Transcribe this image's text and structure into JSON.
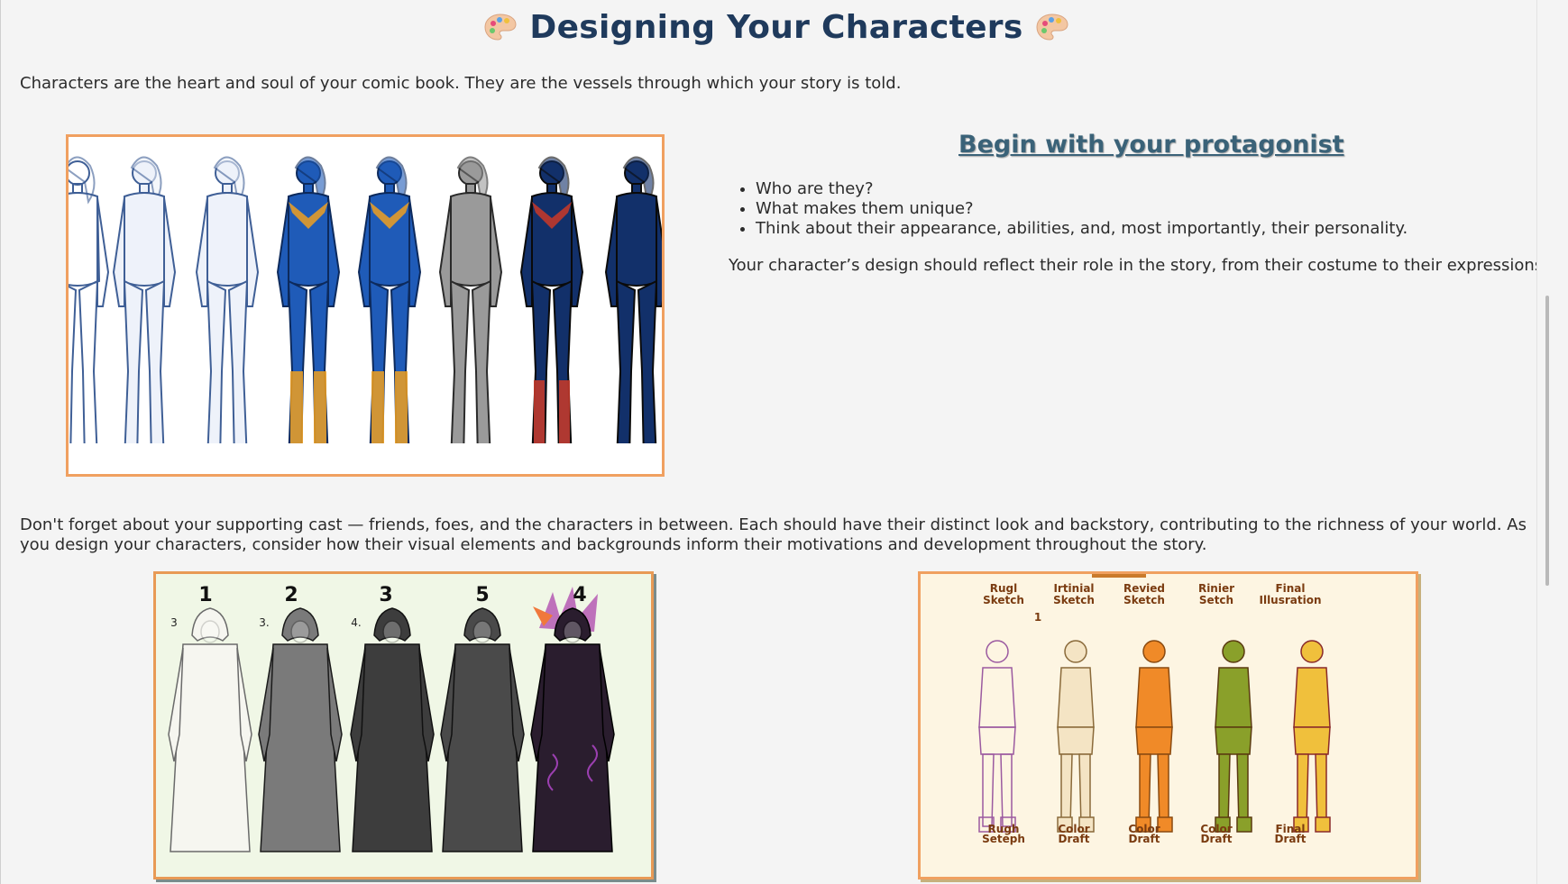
{
  "page": {
    "title": "Designing Your Characters",
    "title_icon": "artist-palette-icon",
    "intro": "Characters are the heart and soul of your comic book. They are the vessels through which your story is told."
  },
  "protagonist": {
    "heading": "Begin with your protagonist",
    "questions": [
      "Who are they?",
      "What makes them unique?",
      "Think about their appearance, abilities, and, most importantly, their personality."
    ],
    "note": "Your character’s design should reflect their role in the story, from their costume to their expressions."
  },
  "supporting": {
    "text": "Don't forget about your supporting cast — friends, foes, and the characters in between. Each should have their distinct look and backstory, contributing to the richness of your world. As you design your characters, consider how their visual elements and backgrounds inform their motivations and development throughout the story."
  },
  "villain_image": {
    "top_numbers": [
      "1",
      "2",
      "3",
      "5",
      "4"
    ],
    "side_numbers": [
      "3",
      "3.",
      "4."
    ]
  },
  "heroine_image": {
    "top_labels": [
      [
        "Rugl",
        "Sketch"
      ],
      [
        "Irtinial",
        "Sketch"
      ],
      [
        "Revied",
        "Sketch"
      ],
      [
        "Rinier",
        "Setch"
      ],
      [
        "Final",
        "Illusration"
      ]
    ],
    "marker": "1",
    "bottom_labels": [
      [
        "Rugh",
        "Seteph"
      ],
      [
        "Color",
        "Draft"
      ],
      [
        "Color",
        "Draft"
      ],
      [
        "Color",
        "Draft"
      ],
      [
        "Final",
        "Draft"
      ]
    ]
  },
  "colors": {
    "title": "#1f3a5c",
    "link_heading": "#3a6278",
    "frame_border": "#f0a060",
    "page_bg": "#f4f4f4"
  }
}
